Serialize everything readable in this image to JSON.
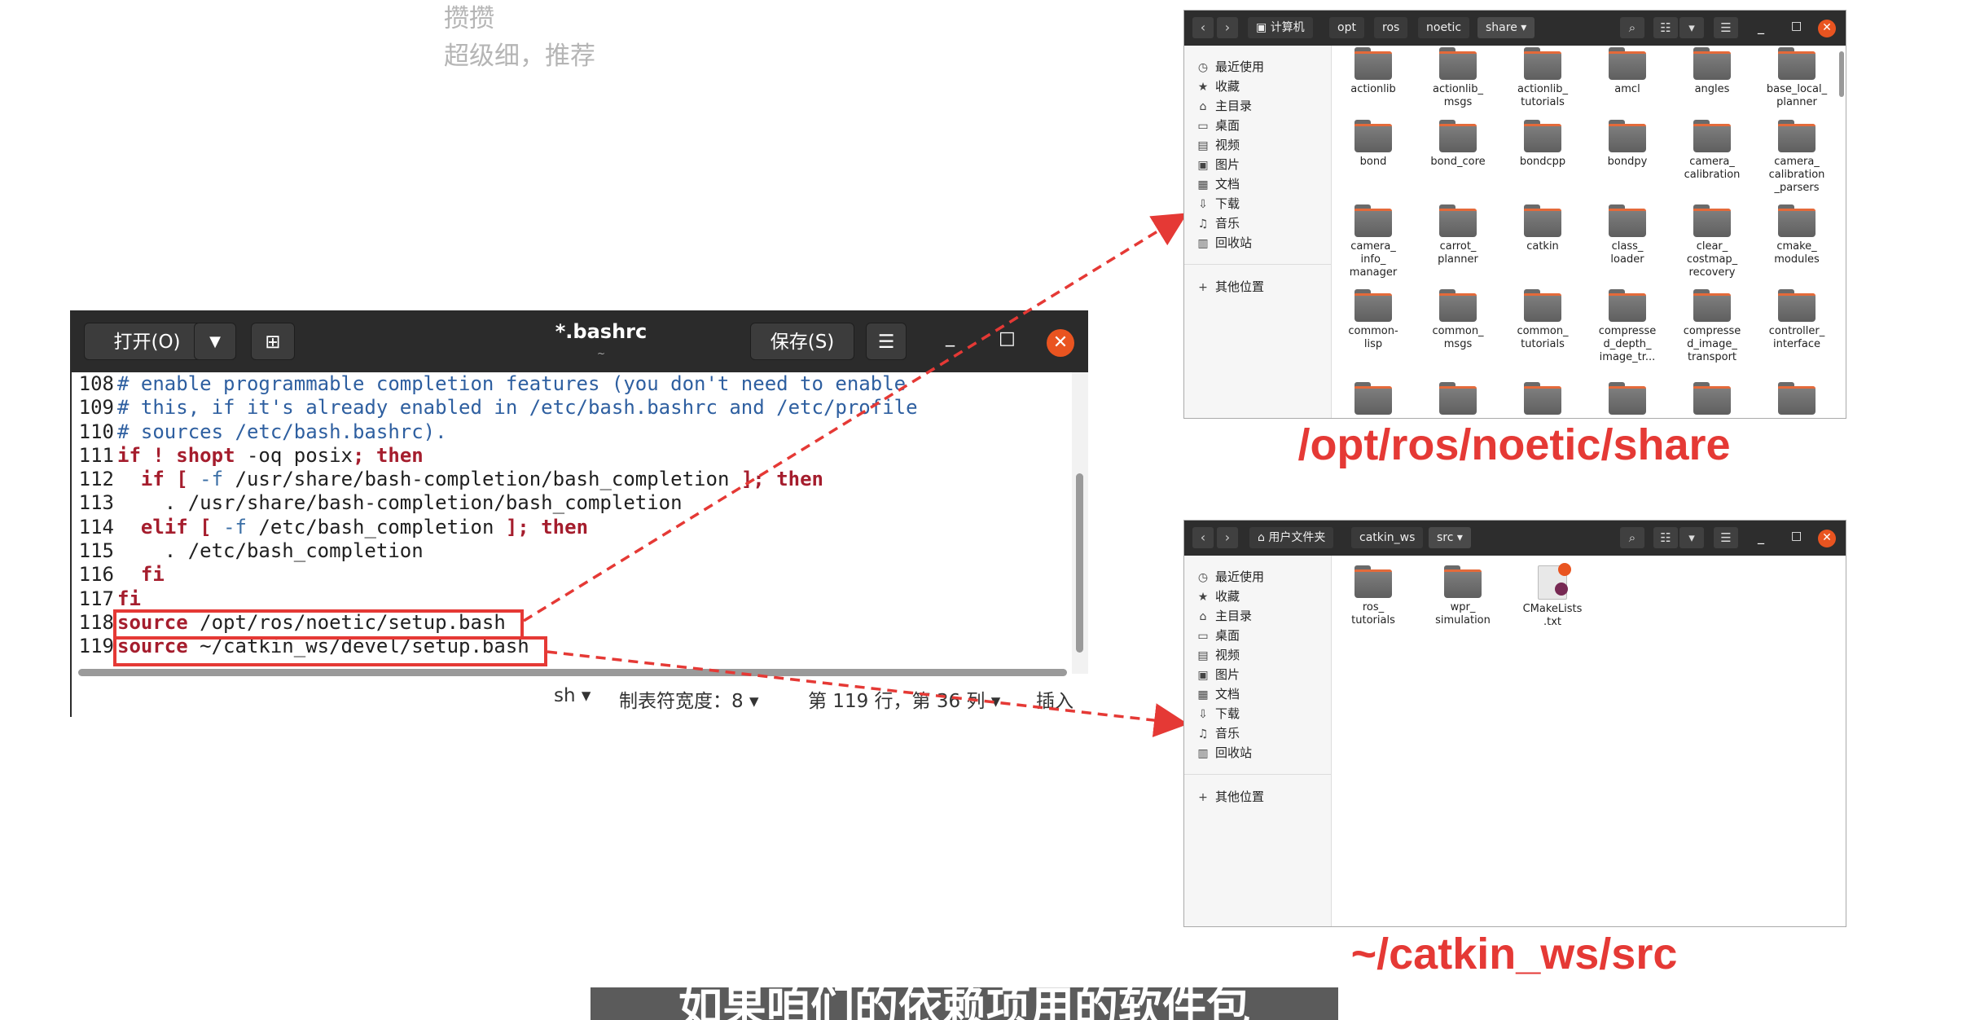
{
  "comments": [
    "攒攒",
    "超级细，推荐"
  ],
  "editor": {
    "open_label": "打开(O)",
    "save_label": "保存(S)",
    "title": "*.bashrc",
    "subtitle": "~",
    "status": {
      "lang": "sh ▾",
      "tab_width": "制表符宽度：8 ▾",
      "position": "第 119 行，第 36 列 ▾",
      "mode": "插入"
    },
    "lines": [
      {
        "n": "108",
        "segs": [
          {
            "c": "cm",
            "t": "# enable programmable completion features (you don't need to enable"
          }
        ]
      },
      {
        "n": "109",
        "segs": [
          {
            "c": "cm",
            "t": "# this, if it's already enabled in /etc/bash.bashrc and /etc/profile"
          }
        ]
      },
      {
        "n": "110",
        "segs": [
          {
            "c": "cm",
            "t": "# sources /etc/bash.bashrc)."
          }
        ]
      },
      {
        "n": "111",
        "segs": [
          {
            "c": "kw",
            "t": "if"
          },
          {
            "c": "tx",
            "t": " "
          },
          {
            "c": "op",
            "t": "!"
          },
          {
            "c": "tx",
            "t": " "
          },
          {
            "c": "kw",
            "t": "shopt"
          },
          {
            "c": "tx",
            "t": " -oq posix"
          },
          {
            "c": "op",
            "t": ";"
          },
          {
            "c": "tx",
            "t": " "
          },
          {
            "c": "kw",
            "t": "then"
          }
        ]
      },
      {
        "n": "112",
        "segs": [
          {
            "c": "tx",
            "t": "  "
          },
          {
            "c": "kw",
            "t": "if"
          },
          {
            "c": "tx",
            "t": " "
          },
          {
            "c": "op",
            "t": "["
          },
          {
            "c": "tx",
            "t": " "
          },
          {
            "c": "opt",
            "t": "-f"
          },
          {
            "c": "tx",
            "t": " /usr/share/bash-completion/bash_completion "
          },
          {
            "c": "op",
            "t": "];"
          },
          {
            "c": "tx",
            "t": " "
          },
          {
            "c": "kw",
            "t": "then"
          }
        ]
      },
      {
        "n": "113",
        "segs": [
          {
            "c": "tx",
            "t": "    . /usr/share/bash-completion/bash_completion"
          }
        ]
      },
      {
        "n": "114",
        "segs": [
          {
            "c": "tx",
            "t": "  "
          },
          {
            "c": "kw",
            "t": "elif"
          },
          {
            "c": "tx",
            "t": " "
          },
          {
            "c": "op",
            "t": "["
          },
          {
            "c": "tx",
            "t": " "
          },
          {
            "c": "opt",
            "t": "-f"
          },
          {
            "c": "tx",
            "t": " /etc/bash_completion "
          },
          {
            "c": "op",
            "t": "];"
          },
          {
            "c": "tx",
            "t": " "
          },
          {
            "c": "kw",
            "t": "then"
          }
        ]
      },
      {
        "n": "115",
        "segs": [
          {
            "c": "tx",
            "t": "    . /etc/bash_completion"
          }
        ]
      },
      {
        "n": "116",
        "segs": [
          {
            "c": "tx",
            "t": "  "
          },
          {
            "c": "kw",
            "t": "fi"
          }
        ]
      },
      {
        "n": "117",
        "segs": [
          {
            "c": "kw",
            "t": "fi"
          }
        ]
      },
      {
        "n": "118",
        "segs": [
          {
            "c": "kw",
            "t": "source"
          },
          {
            "c": "tx",
            "t": " /opt/ros/noetic/setup.bash"
          }
        ]
      },
      {
        "n": "119",
        "segs": [
          {
            "c": "kw",
            "t": "source"
          },
          {
            "c": "tx",
            "t": " ~/catkin_ws/devel/setup.bash"
          }
        ]
      }
    ]
  },
  "fm_top": {
    "crumbs": [
      "计算机",
      "opt",
      "ros",
      "noetic",
      "share ▾"
    ],
    "sidebar": [
      {
        "icon": "◷",
        "label": "最近使用"
      },
      {
        "icon": "★",
        "label": "收藏"
      },
      {
        "icon": "⌂",
        "label": "主目录"
      },
      {
        "icon": "▭",
        "label": "桌面"
      },
      {
        "icon": "▤",
        "label": "视频"
      },
      {
        "icon": "▣",
        "label": "图片"
      },
      {
        "icon": "▦",
        "label": "文档"
      },
      {
        "icon": "⇩",
        "label": "下载"
      },
      {
        "icon": "♫",
        "label": "音乐"
      },
      {
        "icon": "▥",
        "label": "回收站"
      }
    ],
    "other": "其他位置",
    "items": [
      "actionlib",
      "actionlib_\nmsgs",
      "actionlib_\ntutorials",
      "amcl",
      "angles",
      "base_local_\nplanner",
      "bond",
      "bond_core",
      "bondcpp",
      "bondpy",
      "camera_\ncalibration",
      "camera_\ncalibration\n_parsers",
      "camera_\ninfo_\nmanager",
      "carrot_\nplanner",
      "catkin",
      "class_\nloader",
      "clear_\ncostmap_\nrecovery",
      "cmake_\nmodules",
      "common-\nlisp",
      "common_\nmsgs",
      "common_\ntutorials",
      "compresse\nd_depth_\nimage_tr...",
      "compresse\nd_image_\ntransport",
      "controller_\ninterface"
    ],
    "caption": "/opt/ros/noetic/share"
  },
  "fm_bottom": {
    "crumbs": [
      "⌂ 用户文件夹",
      "catkin_ws",
      "src ▾"
    ],
    "sidebar": [
      {
        "icon": "◷",
        "label": "最近使用"
      },
      {
        "icon": "★",
        "label": "收藏"
      },
      {
        "icon": "⌂",
        "label": "主目录"
      },
      {
        "icon": "▭",
        "label": "桌面"
      },
      {
        "icon": "▤",
        "label": "视频"
      },
      {
        "icon": "▣",
        "label": "图片"
      },
      {
        "icon": "▦",
        "label": "文档"
      },
      {
        "icon": "⇩",
        "label": "下载"
      },
      {
        "icon": "♫",
        "label": "音乐"
      },
      {
        "icon": "▥",
        "label": "回收站"
      }
    ],
    "other": "其他位置",
    "items": [
      "ros_\ntutorials",
      "wpr_\nsimulation",
      "CMakeLists\n.txt"
    ],
    "caption": "~/catkin_ws/src"
  },
  "subtitle": "如果咱们的依赖项用的软件包"
}
